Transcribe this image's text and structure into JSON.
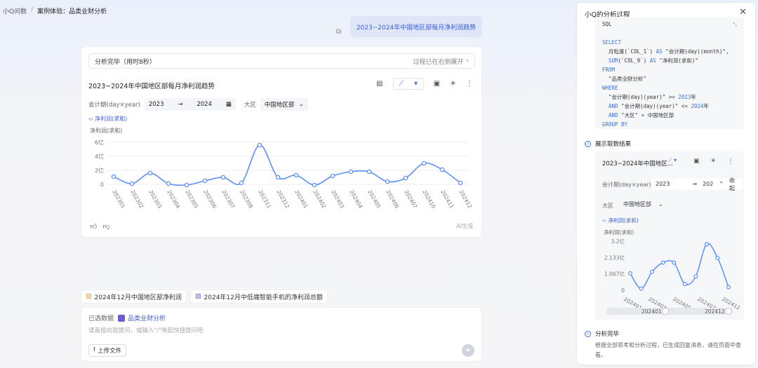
{
  "breadcrumb": {
    "root": "小Q问数",
    "sep": "/",
    "current": "案例体验：品类业财分析"
  },
  "user_message": "2023~2024年中国地区部每月净利润趋势",
  "result": {
    "status_label": "分析完毕（用时8秒）",
    "process_link": "过程已在右侧展开",
    "chart_title": "2023~2024年中国地区部每月净利润趋势",
    "filter_date_label": "会计期(day×year)",
    "date_from": "2023",
    "date_arrow": "→",
    "date_to": "2024",
    "filter_region_label": "大区",
    "region_value": "中国地区部",
    "series_tag": "净利润(求和)",
    "y_label": "净利润(求和)",
    "ai_generated": "AI生成"
  },
  "chart_data": {
    "type": "line",
    "x": [
      "202301",
      "202302",
      "202303",
      "202304",
      "202305",
      "202306",
      "202307",
      "202308",
      "202311",
      "202312",
      "202401",
      "202402",
      "202403",
      "202404",
      "202405",
      "202406",
      "202407",
      "202410",
      "202411",
      "202412"
    ],
    "series": [
      {
        "name": "净利润(求和)",
        "values": [
          1.1,
          0.1,
          1.6,
          0.1,
          -0.1,
          0.5,
          1.0,
          0.2,
          5.6,
          1.0,
          1.3,
          -0.1,
          1.2,
          1.8,
          1.8,
          0.4,
          0.9,
          3.0,
          2.1,
          0.2
        ]
      }
    ],
    "ylabel": "净利润(求和)",
    "yticks": [
      "6亿",
      "4亿",
      "2亿",
      "0"
    ],
    "ylim": [
      0,
      6
    ],
    "grid": true,
    "color": "#5b8ff9"
  },
  "suggestions": [
    "2024年12月中国地区部净利润",
    "2024年12月中低端智能手机的净利润总额"
  ],
  "input": {
    "selected_label": "已选数据",
    "dataset": "品类业财分析",
    "placeholder": "请直接向我提问，或输入\"/\"唤起快捷提问吧",
    "upload_label": "上传文件"
  },
  "panel": {
    "title": "小Q的分析过程",
    "sql_label": "SQL",
    "step_fetch": "展示取数结果",
    "mini_title": "2023~2024年中国地区...",
    "mini_date_label": "会计期(day×year)",
    "mini_date_from": "2023",
    "mini_date_to": "202",
    "mini_collapse": "收起",
    "mini_region_label": "大区",
    "mini_region_value": "中国地区部",
    "mini_series": "净利润(求和)",
    "mini_ylabel": "净利润(求和)",
    "mini_yticks": [
      "3.2亿",
      "2.133亿",
      "1.067亿",
      "0"
    ],
    "mini_xticks": [
      "202401",
      "202403",
      "202405",
      "202407",
      "202412"
    ],
    "mini_range_from": "202401",
    "mini_range_to": "202412",
    "step_done": "分析完毕",
    "done_text": "根据全部思考和分析过程，已生成回复消息，请在页面中查看。"
  },
  "mini_chart_data": {
    "type": "line",
    "values": [
      1.1,
      0.1,
      1.2,
      1.8,
      1.8,
      0.4,
      0.9,
      3.0,
      2.1,
      0.2
    ],
    "ylim": [
      0,
      3.2
    ],
    "color": "#5b8ff9"
  }
}
